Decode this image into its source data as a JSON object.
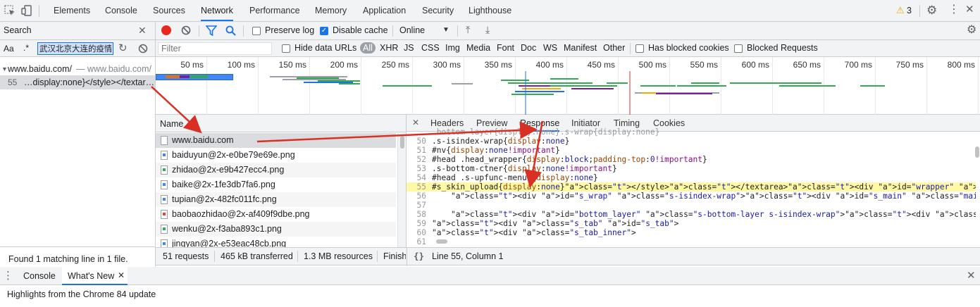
{
  "main_tabs": [
    "Elements",
    "Console",
    "Sources",
    "Network",
    "Performance",
    "Memory",
    "Application",
    "Security",
    "Lighthouse"
  ],
  "selected_tab": "Network",
  "warnings_count": "3",
  "search": {
    "title": "Search",
    "case_label": "Aa",
    "regex_label": ".*",
    "query": "武汉北京大连的疫情",
    "result_host": "www.baidu.com/",
    "result_host_sub": "— www.baidu.com/",
    "result_line_no": "55",
    "result_line_text": "…display:none}</style></textar…",
    "status": "Found 1 matching line in 1 file."
  },
  "toolbar": {
    "preserve_log": "Preserve log",
    "disable_cache": "Disable cache",
    "throttle": "Online"
  },
  "filter_bar": {
    "placeholder": "Filter",
    "hide_data_urls": "Hide data URLs",
    "types": [
      "All",
      "XHR",
      "JS",
      "CSS",
      "Img",
      "Media",
      "Font",
      "Doc",
      "WS",
      "Manifest",
      "Other"
    ],
    "has_blocked_cookies": "Has blocked cookies",
    "blocked_requests": "Blocked Requests"
  },
  "timeline_labels": [
    "50 ms",
    "100 ms",
    "150 ms",
    "200 ms",
    "250 ms",
    "300 ms",
    "350 ms",
    "400 ms",
    "450 ms",
    "500 ms",
    "550 ms",
    "600 ms",
    "650 ms",
    "700 ms",
    "750 ms",
    "800 ms"
  ],
  "name_header": "Name",
  "requests": [
    "www.baidu.com",
    "baiduyun@2x-e0be79e69e.png",
    "zhidao@2x-e9b427ecc4.png",
    "baike@2x-1fe3db7fa6.png",
    "tupian@2x-482fc011fc.png",
    "baobaozhidao@2x-af409f9dbe.png",
    "wenku@2x-f3aba893c1.png",
    "jingyan@2x-e53eac48cb.png"
  ],
  "detail_tabs": [
    "Headers",
    "Preview",
    "Response",
    "Initiator",
    "Timing",
    "Cookies"
  ],
  "selected_detail_tab": "Response",
  "code_lines": [
    {
      "n": "50",
      "t": ".s-isindex-wrap{display:none}"
    },
    {
      "n": "51",
      "t": "#nv{display:none!important}"
    },
    {
      "n": "52",
      "t": "#head .head_wrapper{display:block;padding-top:0!important}"
    },
    {
      "n": "53",
      "t": ".s-bottom-ctner{display:none!important}"
    },
    {
      "n": "54",
      "t": "#head .s-upfunc-menus{display:none}"
    },
    {
      "n": "55",
      "t": "#s_skin_upload{display:none}</style></textarea><div id=\"wrapper\" class=\"wrapper_new\"><script>if(window.bds"
    },
    {
      "n": "56",
      "t": "    <div id=\"s_wrap\" class=\"s-isindex-wrap\"><div id=\"s_main\" class=\"main clearfix \"></div></div>"
    },
    {
      "n": "57",
      "t": ""
    },
    {
      "n": "58",
      "t": "    <div id=\"bottom_layer\" class=\"s-bottom-layer s-isindex-wrap\"><div class=\"s-bottom-layer-left\"><p clas"
    },
    {
      "n": "59",
      "t": "<div class=\"s_tab\" id=\"s_tab\">"
    },
    {
      "n": "60",
      "t": "<div class=\"s_tab_inner\">"
    },
    {
      "n": "61",
      "t": ""
    }
  ],
  "status": {
    "requests": "51 requests",
    "transferred": "465 kB transferred",
    "resources": "1.3 MB resources",
    "finish": "Finish",
    "position": "Line 55, Column 1",
    "braces": "{}"
  },
  "drawer": {
    "tabs": [
      "Console",
      "What's New"
    ],
    "message": "Highlights from the Chrome 84 update"
  },
  "colors": {
    "accent": "#1a73e8",
    "highlight_line": "#fff9a6",
    "annotation_arrow": "#d93025",
    "record": "#e8281e"
  }
}
